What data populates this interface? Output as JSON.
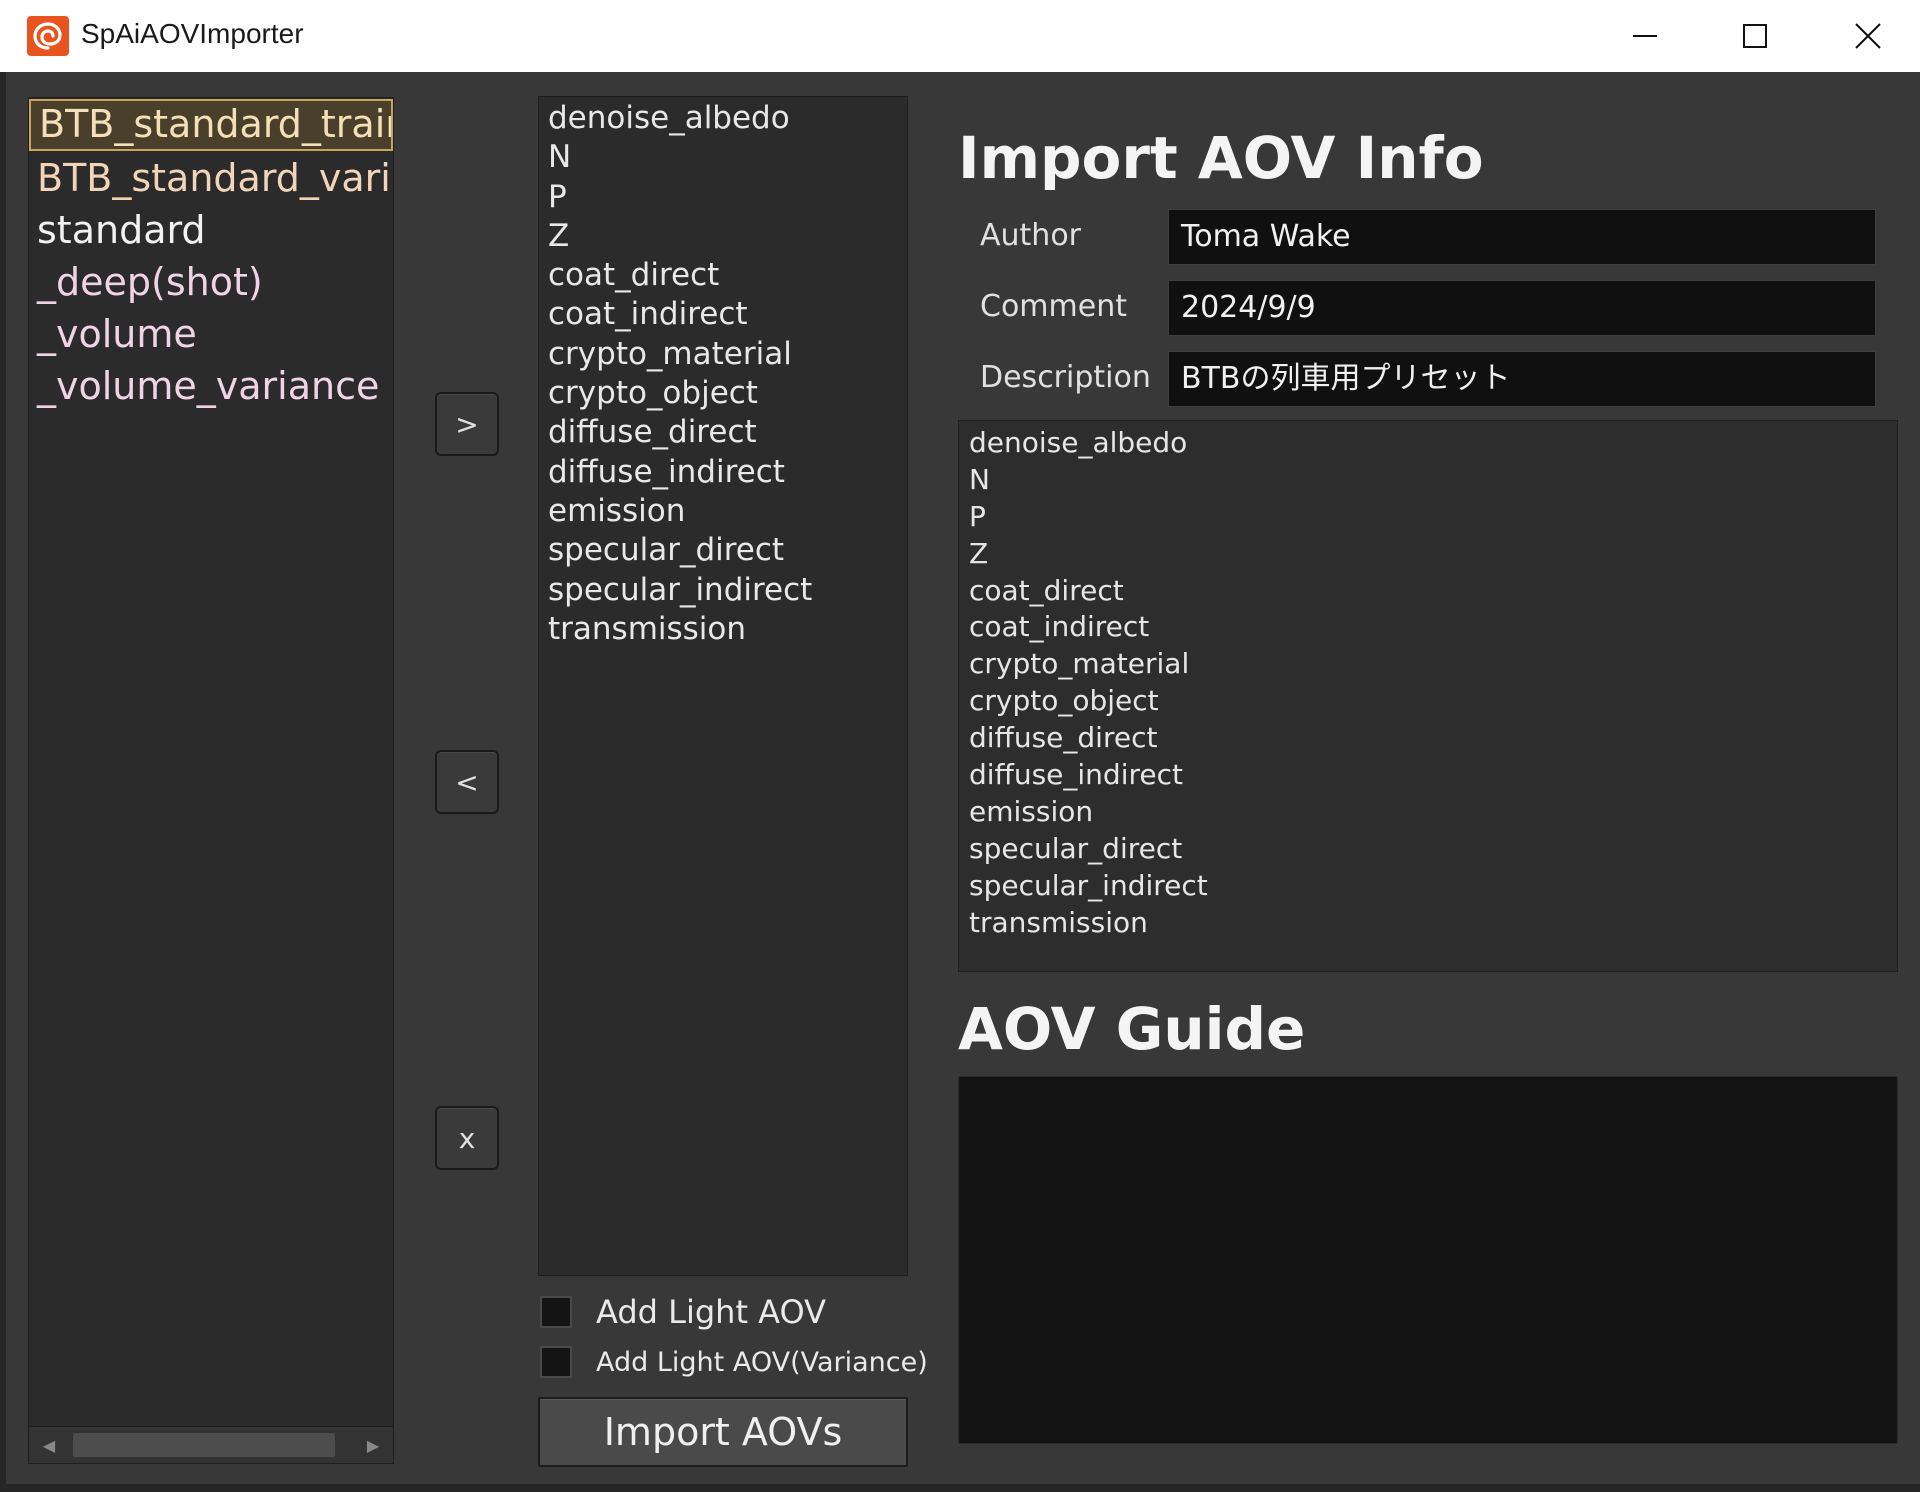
{
  "window": {
    "title": "SpAiAOVImporter",
    "icon": "houdini-swirl-icon",
    "accent": "#e8541f"
  },
  "presets": {
    "items": [
      {
        "label": "BTB_standard_train",
        "selected": true
      },
      {
        "label": "BTB_standard_variance",
        "selected": false
      },
      {
        "label": "standard",
        "selected": false
      },
      {
        "label": "_deep(shot)",
        "selected": false
      },
      {
        "label": "_volume",
        "selected": false
      },
      {
        "label": "_volume_variance",
        "selected": false
      }
    ]
  },
  "buttons": {
    "add": ">",
    "remove": "<",
    "clear": "x",
    "import": "Import AOVs"
  },
  "aovs": [
    "denoise_albedo",
    "N",
    "P",
    "Z",
    "coat_direct",
    "coat_indirect",
    "crypto_material",
    "crypto_object",
    "diffuse_direct",
    "diffuse_indirect",
    "emission",
    "specular_direct",
    "specular_indirect",
    "transmission"
  ],
  "options": {
    "add_light_aov": {
      "label": "Add Light AOV",
      "checked": false
    },
    "add_light_aov_variance": {
      "label": "Add Light AOV(Variance)",
      "checked": false
    }
  },
  "info": {
    "heading": "Import AOV Info",
    "author_label": "Author",
    "author_value": "Toma Wake",
    "comment_label": "Comment",
    "comment_value": "2024/9/9",
    "description_label": "Description",
    "description_value": "BTBの列車用プリセット",
    "aov_list": [
      "denoise_albedo",
      "N",
      "P",
      "Z",
      "coat_direct",
      "coat_indirect",
      "crypto_material",
      "crypto_object",
      "diffuse_direct",
      "diffuse_indirect",
      "emission",
      "specular_direct",
      "specular_indirect",
      "transmission"
    ]
  },
  "guide": {
    "heading": "AOV Guide",
    "content": ""
  }
}
